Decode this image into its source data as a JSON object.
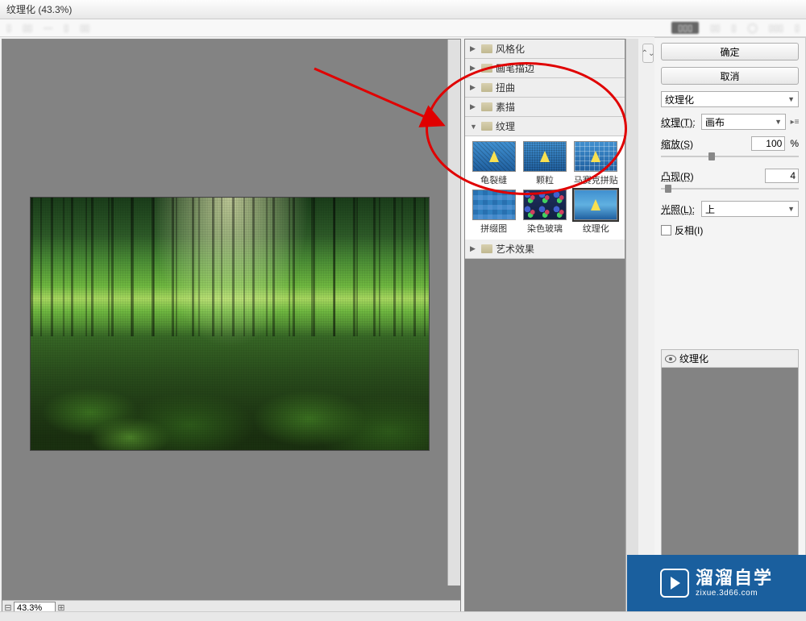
{
  "title": "纹理化 (43.3%)",
  "zoom_value": "43.3%",
  "buttons": {
    "ok": "确定",
    "cancel": "取消"
  },
  "filter_dropdown": "纹理化",
  "categories": [
    {
      "name": "风格化",
      "expanded": false
    },
    {
      "name": "画笔描边",
      "expanded": false
    },
    {
      "name": "扭曲",
      "expanded": false
    },
    {
      "name": "素描",
      "expanded": false
    },
    {
      "name": "纹理",
      "expanded": true
    },
    {
      "name": "艺术效果",
      "expanded": false
    }
  ],
  "texture_filters": [
    {
      "name": "龟裂缝",
      "style": "craquelure"
    },
    {
      "name": "颗粒",
      "style": "grain"
    },
    {
      "name": "马赛克拼贴",
      "style": "mosaic"
    },
    {
      "name": "拼缀图",
      "style": "patchwork"
    },
    {
      "name": "染色玻璃",
      "style": "stained"
    },
    {
      "name": "纹理化",
      "style": "texturizer",
      "selected": true
    }
  ],
  "settings": {
    "texture_label": "纹理(T):",
    "texture_value": "画布",
    "scaling_label": "缩放(S)",
    "scaling_value": "100",
    "scaling_pct": 37,
    "percent": "%",
    "relief_label": "凸现(R)",
    "relief_value": "4",
    "relief_pct": 5,
    "light_label": "光照(L):",
    "light_value": "上",
    "invert_label": "反相(I)"
  },
  "layers_panel_title": "纹理化",
  "watermark": {
    "cn": "溜溜自学",
    "url": "zixue.3d66.com"
  }
}
